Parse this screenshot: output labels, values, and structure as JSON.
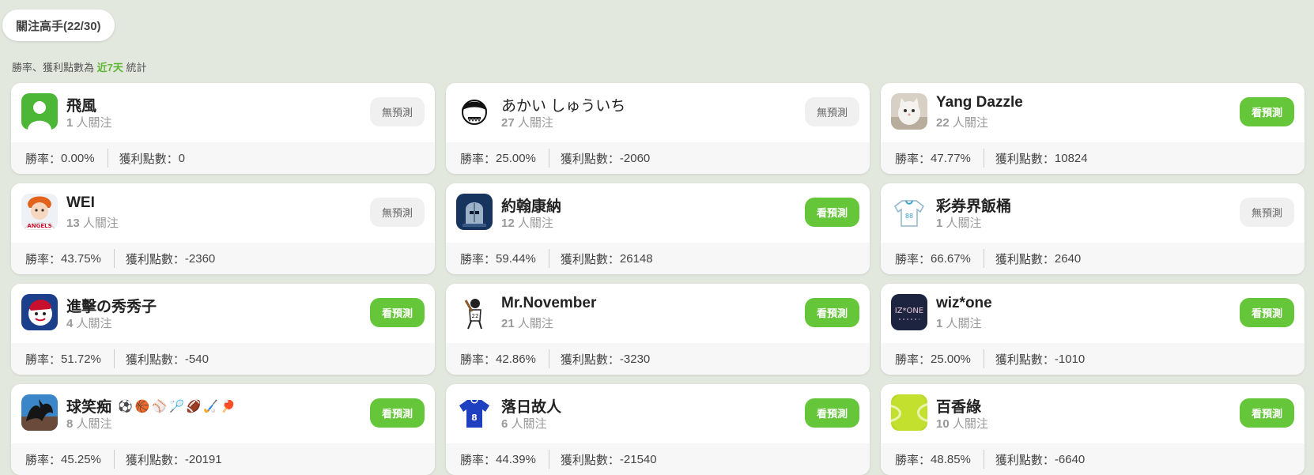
{
  "header": {
    "tab_label": "關注高手(22/30)",
    "note_prefix": "勝率、獲利點數為 ",
    "note_highlight": "近7天",
    "note_suffix": " 統計"
  },
  "labels": {
    "win_rate": "勝率：",
    "profit": "獲利點數：",
    "followers_suffix": " 人關注"
  },
  "colors": {
    "accent_green": "#66c63a",
    "background": "#e3e8df"
  },
  "experts": [
    {
      "name": "飛風",
      "followers": "1",
      "button": "無預測",
      "has_prediction": false,
      "win_rate": "0.00%",
      "profit": "0",
      "avatar": "default-user-avatar"
    },
    {
      "name": "あかい しゅういち",
      "followers": "27",
      "button": "無預測",
      "has_prediction": false,
      "win_rate": "25.00%",
      "profit": "-2060",
      "avatar": "cartoon-face-avatar"
    },
    {
      "name": "Yang Dazzle",
      "followers": "22",
      "button": "看預測",
      "has_prediction": true,
      "win_rate": "47.77%",
      "profit": "10824",
      "avatar": "white-cat-avatar"
    },
    {
      "name": "WEI",
      "followers": "13",
      "button": "無預測",
      "has_prediction": false,
      "win_rate": "43.75%",
      "profit": "-2360",
      "avatar": "angels-player-avatar"
    },
    {
      "name": "約翰康納",
      "followers": "12",
      "button": "看預測",
      "has_prediction": true,
      "win_rate": "59.44%",
      "profit": "26148",
      "avatar": "knight-helmet-avatar"
    },
    {
      "name": "彩券界飯桶",
      "followers": "1",
      "button": "無預測",
      "has_prediction": false,
      "win_rate": "66.67%",
      "profit": "2640",
      "avatar": "jersey-avatar"
    },
    {
      "name": "進擊の秀秀子",
      "followers": "4",
      "button": "看預測",
      "has_prediction": true,
      "win_rate": "51.72%",
      "profit": "-540",
      "avatar": "baseball-mascot-avatar"
    },
    {
      "name": "Mr.November",
      "followers": "21",
      "button": "看預測",
      "has_prediction": true,
      "win_rate": "42.86%",
      "profit": "-3230",
      "avatar": "batter-sketch-avatar"
    },
    {
      "name": "wiz*one",
      "followers": "1",
      "button": "看預測",
      "has_prediction": true,
      "win_rate": "25.00%",
      "profit": "-1010",
      "avatar": "izone-logo-avatar",
      "avatar_text": "IZ*ONE"
    },
    {
      "name": "球笑痴",
      "followers": "8",
      "button": "看預測",
      "has_prediction": true,
      "win_rate": "45.25%",
      "profit": "-20191",
      "avatar": "dragon-avatar",
      "sports": "⚽🏀⚾🏸🏈🏑🏓"
    },
    {
      "name": "落日故人",
      "followers": "6",
      "button": "看預測",
      "has_prediction": true,
      "win_rate": "44.39%",
      "profit": "-21540",
      "avatar": "blue-jersey-avatar"
    },
    {
      "name": "百香綠",
      "followers": "10",
      "button": "看預測",
      "has_prediction": true,
      "win_rate": "48.85%",
      "profit": "-6640",
      "avatar": "tennis-ball-avatar"
    }
  ]
}
